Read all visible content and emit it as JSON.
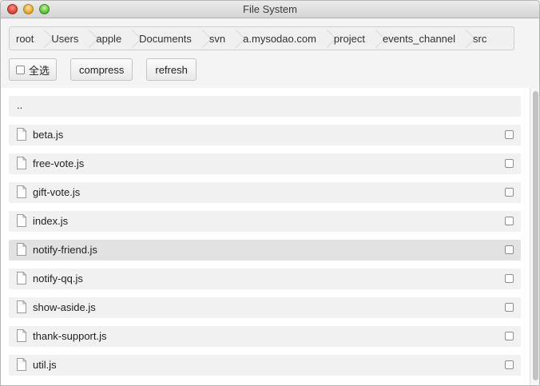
{
  "window": {
    "title": "File System"
  },
  "breadcrumb": [
    "root",
    "Users",
    "apple",
    "Documents",
    "svn",
    "a.mysodao.com",
    "project",
    "events_channel",
    "src"
  ],
  "toolbar": {
    "select_all_label": "全选",
    "compress_label": "compress",
    "refresh_label": "refresh"
  },
  "files": {
    "parent": "..",
    "items": [
      "beta.js",
      "free-vote.js",
      "gift-vote.js",
      "index.js",
      "notify-friend.js",
      "notify-qq.js",
      "show-aside.js",
      "thank-support.js",
      "util.js"
    ],
    "selected_index": 4
  }
}
